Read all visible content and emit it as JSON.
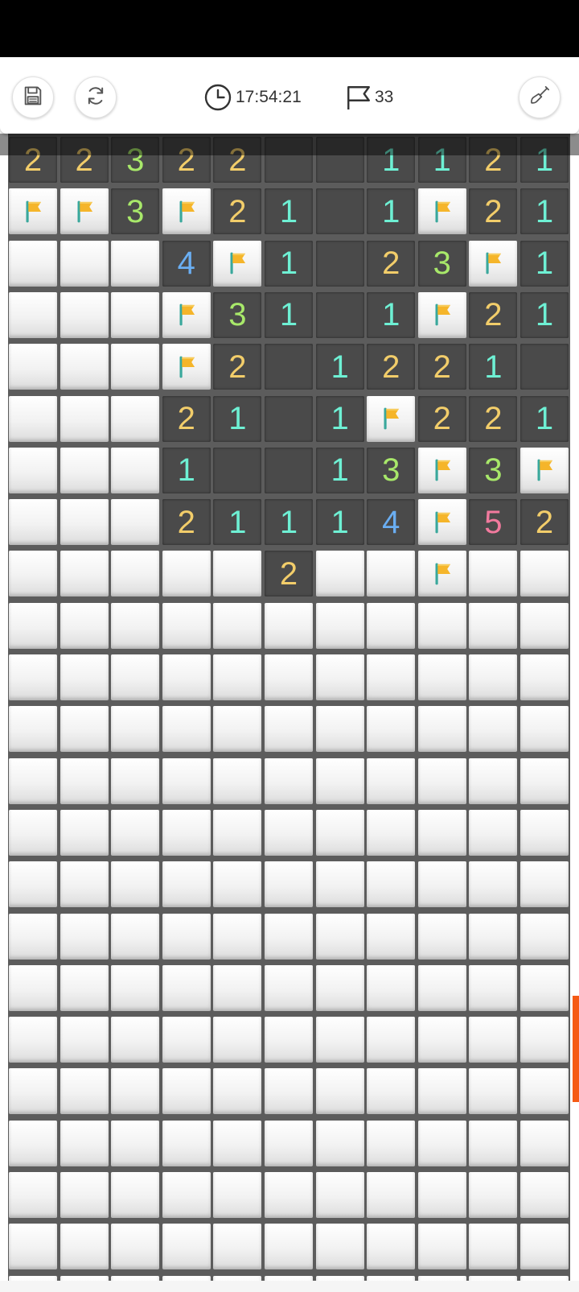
{
  "toolbar": {
    "save_icon": "floppy-disk-icon",
    "refresh_icon": "refresh-icon",
    "timer_icon": "clock-icon",
    "timer_value": "17:54:21",
    "flags_icon": "flag-outline-icon",
    "flags_count": "33",
    "hint_icon": "shovel-icon"
  },
  "board": {
    "columns": 11,
    "visible_rows": 23,
    "legend": "H = covered tile, F = flagged tile, E = opened empty tile, 1-5 = opened tile with number",
    "rows": [
      [
        "2",
        "2",
        "3",
        "2",
        "2",
        "E",
        "E",
        "1",
        "1",
        "2",
        "1"
      ],
      [
        "F",
        "F",
        "3",
        "F",
        "2",
        "1",
        "E",
        "1",
        "F",
        "2",
        "1"
      ],
      [
        "H",
        "H",
        "H",
        "4",
        "F",
        "1",
        "E",
        "2",
        "3",
        "F",
        "1"
      ],
      [
        "H",
        "H",
        "H",
        "F",
        "3",
        "1",
        "E",
        "1",
        "F",
        "2",
        "1"
      ],
      [
        "H",
        "H",
        "H",
        "F",
        "2",
        "E",
        "1",
        "2",
        "2",
        "1",
        "E"
      ],
      [
        "H",
        "H",
        "H",
        "2",
        "1",
        "E",
        "1",
        "F",
        "2",
        "2",
        "1"
      ],
      [
        "H",
        "H",
        "H",
        "1",
        "E",
        "E",
        "1",
        "3",
        "F",
        "3",
        "F"
      ],
      [
        "H",
        "H",
        "H",
        "2",
        "1",
        "1",
        "1",
        "4",
        "F",
        "5",
        "2"
      ],
      [
        "H",
        "H",
        "H",
        "H",
        "H",
        "2",
        "H",
        "H",
        "F",
        "H",
        "H"
      ],
      [
        "H",
        "H",
        "H",
        "H",
        "H",
        "H",
        "H",
        "H",
        "H",
        "H",
        "H"
      ],
      [
        "H",
        "H",
        "H",
        "H",
        "H",
        "H",
        "H",
        "H",
        "H",
        "H",
        "H"
      ],
      [
        "H",
        "H",
        "H",
        "H",
        "H",
        "H",
        "H",
        "H",
        "H",
        "H",
        "H"
      ],
      [
        "H",
        "H",
        "H",
        "H",
        "H",
        "H",
        "H",
        "H",
        "H",
        "H",
        "H"
      ],
      [
        "H",
        "H",
        "H",
        "H",
        "H",
        "H",
        "H",
        "H",
        "H",
        "H",
        "H"
      ],
      [
        "H",
        "H",
        "H",
        "H",
        "H",
        "H",
        "H",
        "H",
        "H",
        "H",
        "H"
      ],
      [
        "H",
        "H",
        "H",
        "H",
        "H",
        "H",
        "H",
        "H",
        "H",
        "H",
        "H"
      ],
      [
        "H",
        "H",
        "H",
        "H",
        "H",
        "H",
        "H",
        "H",
        "H",
        "H",
        "H"
      ],
      [
        "H",
        "H",
        "H",
        "H",
        "H",
        "H",
        "H",
        "H",
        "H",
        "H",
        "H"
      ],
      [
        "H",
        "H",
        "H",
        "H",
        "H",
        "H",
        "H",
        "H",
        "H",
        "H",
        "H"
      ],
      [
        "H",
        "H",
        "H",
        "H",
        "H",
        "H",
        "H",
        "H",
        "H",
        "H",
        "H"
      ],
      [
        "H",
        "H",
        "H",
        "H",
        "H",
        "H",
        "H",
        "H",
        "H",
        "H",
        "H"
      ],
      [
        "H",
        "H",
        "H",
        "H",
        "H",
        "H",
        "H",
        "H",
        "H",
        "H",
        "H"
      ],
      [
        "H",
        "H",
        "H",
        "H",
        "H",
        "H",
        "H",
        "H",
        "H",
        "H",
        "H"
      ]
    ]
  },
  "number_colors": {
    "1": "#6ef0d4",
    "2": "#f2cd6a",
    "3": "#a8e86a",
    "4": "#6aaef2",
    "5": "#f27a9e"
  },
  "colors": {
    "board_background": "#5c5c5c",
    "open_cell": "#4a4a4a",
    "flag": "#f5b52a",
    "scroll_thumb": "#f55a14"
  }
}
